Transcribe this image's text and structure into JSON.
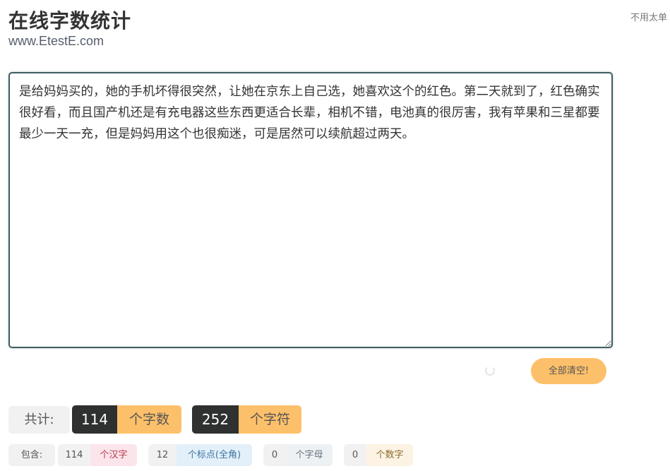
{
  "header": {
    "title": "在线字数统计",
    "url": "www.EtestE.com",
    "side_note": "不用太单"
  },
  "editor": {
    "text": "是给妈妈买的，她的手机坏得很突然，让她在京东上自己选，她喜欢这个的红色。第二天就到了，红色确实很好看，而且国产机还是有充电器这些东西更适合长辈，相机不错，电池真的很厉害，我有苹果和三星都要最少一天一充，但是妈妈用这个也很痴迷，可是居然可以续航超过两天。"
  },
  "actions": {
    "clear_label": "全部清空!"
  },
  "totals": {
    "label": "共计:",
    "chars_count": "114",
    "chars_label": "个字数",
    "symbols_count": "252",
    "symbols_label": "个字符"
  },
  "breakdown": {
    "label": "包含:",
    "items": [
      {
        "count": "114",
        "label": "个汉字",
        "color": "#b9364f"
      },
      {
        "count": "12",
        "label": "个标点(全角)",
        "color": "#3c74a2"
      },
      {
        "count": "0",
        "label": "个字母",
        "color": "#63717f"
      },
      {
        "count": "0",
        "label": "个数字",
        "color": "#8a6a2c"
      }
    ]
  },
  "colors": {
    "accent": "#fdc06a",
    "dark": "#2f3030",
    "border": "#3f5e63"
  }
}
